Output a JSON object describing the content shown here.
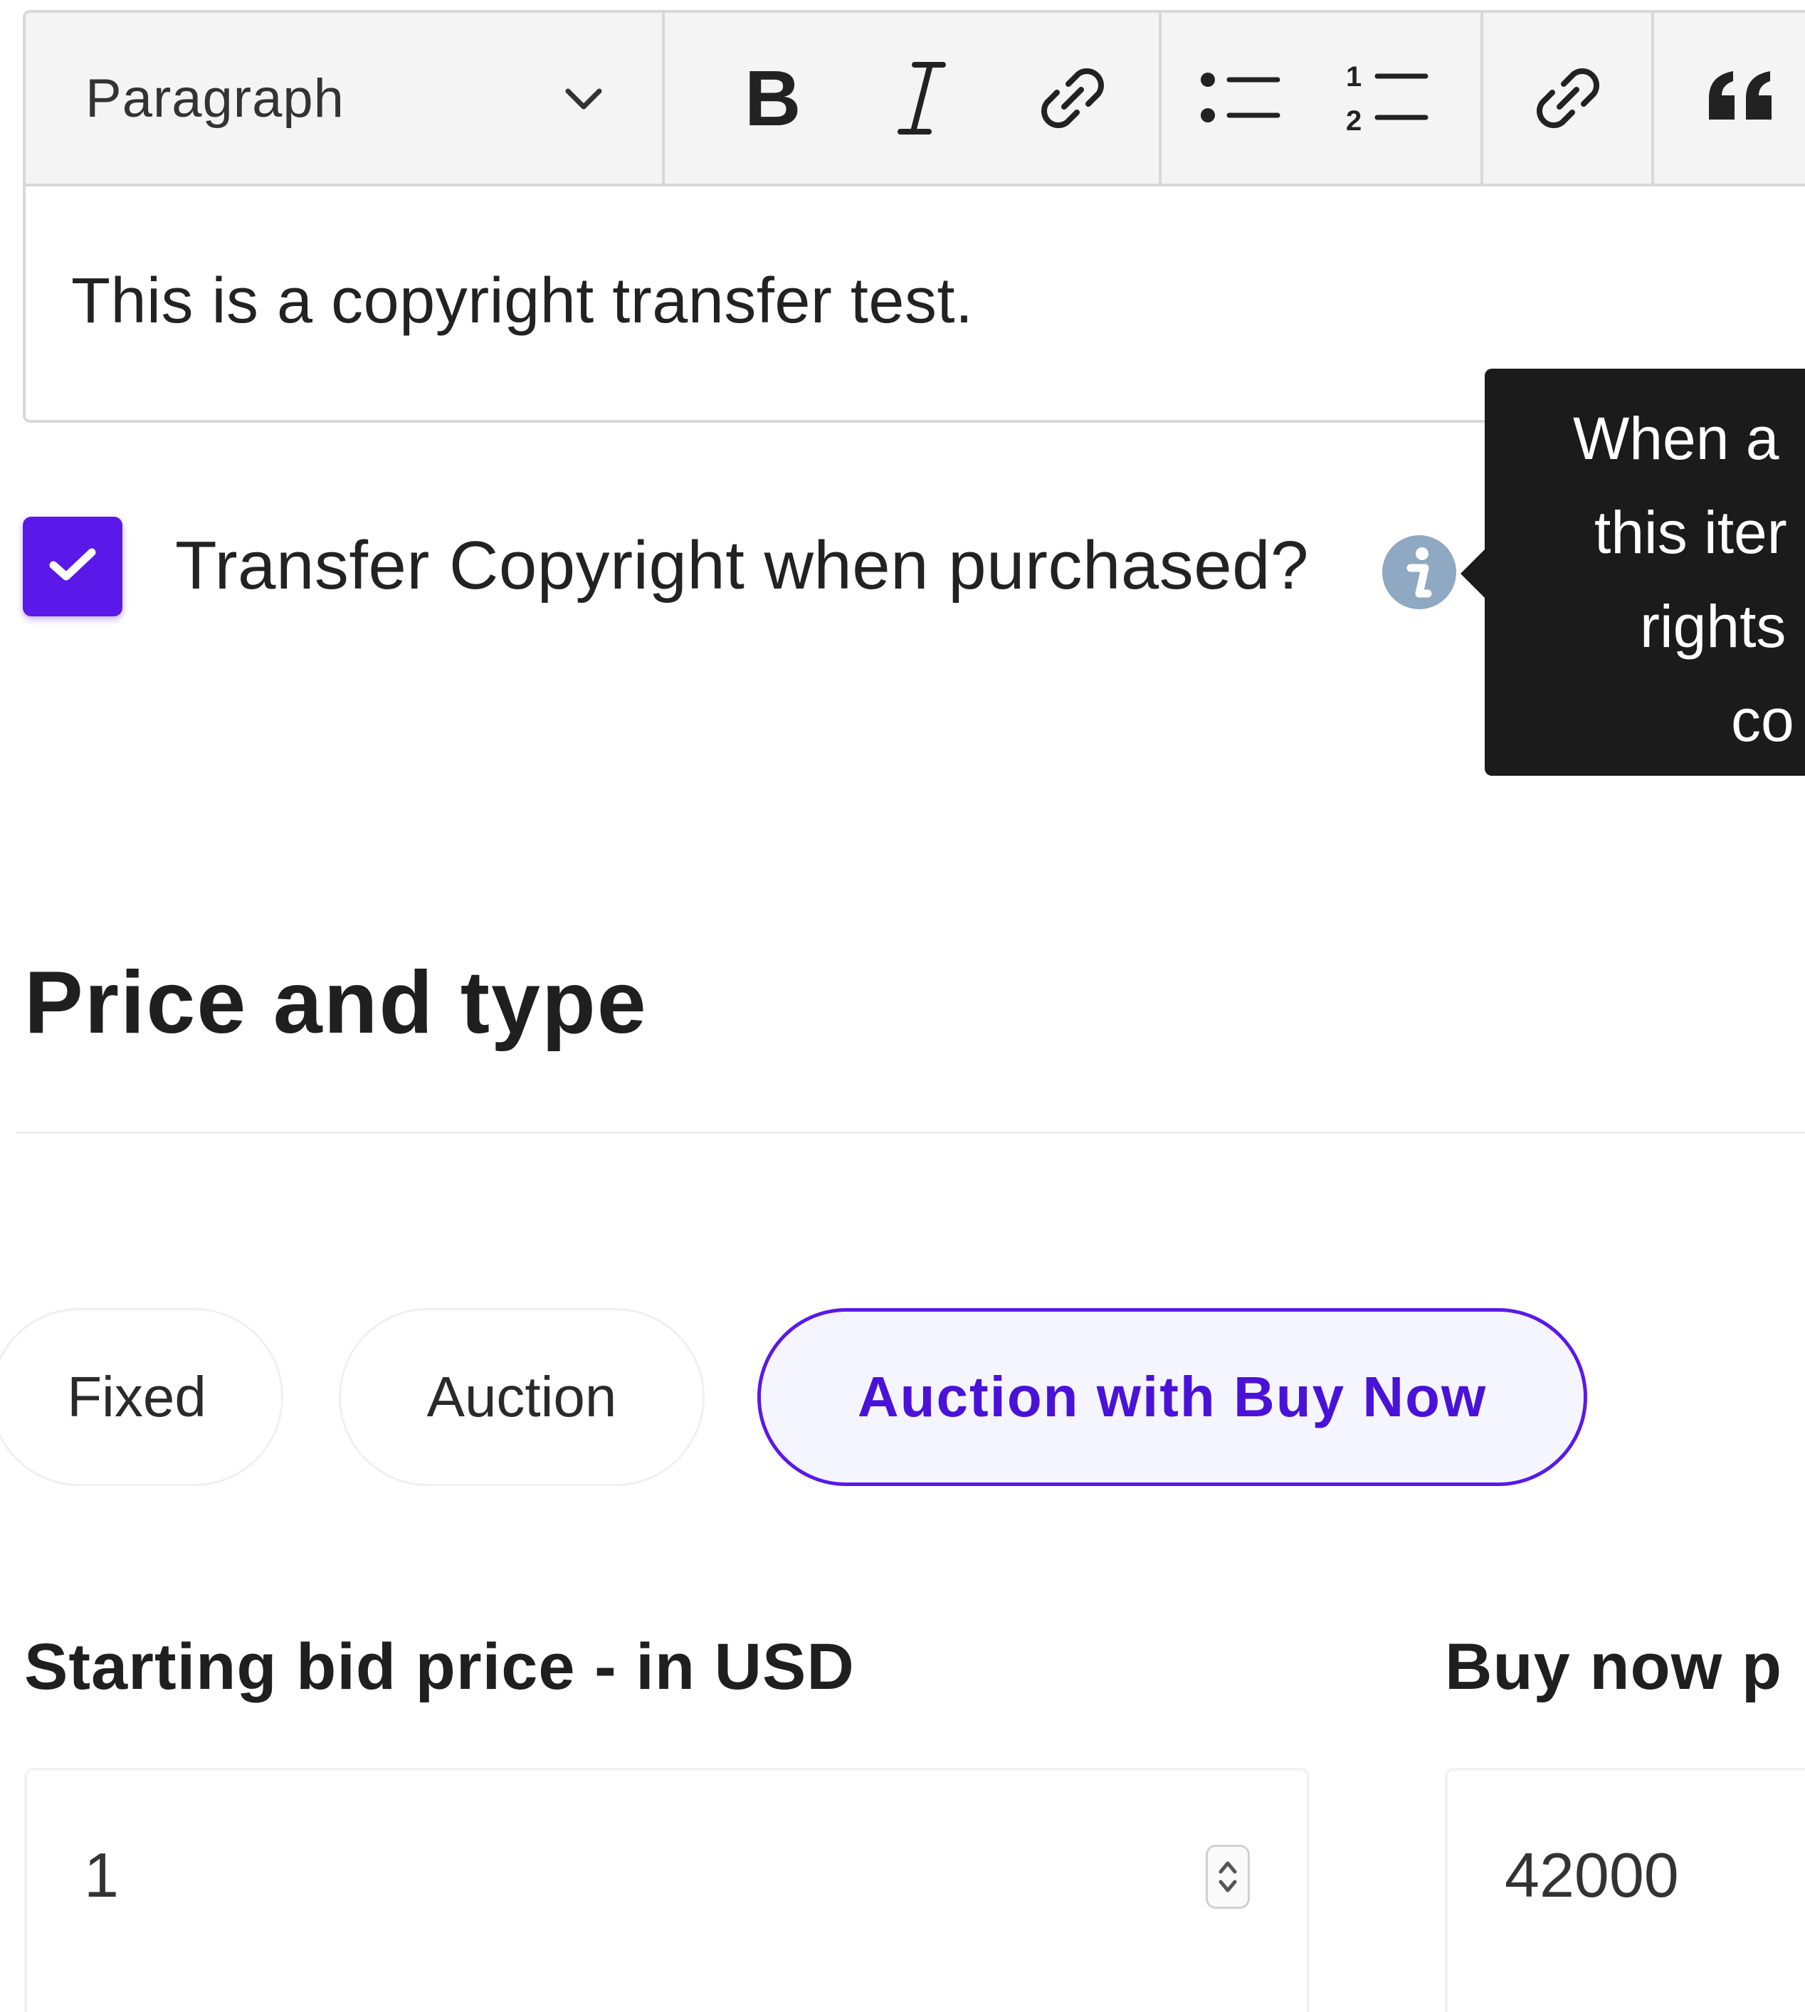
{
  "editor": {
    "format_select": {
      "value": "Paragraph",
      "icon": "chevron-down-icon"
    },
    "toolbar_icons": [
      "bold-icon",
      "italic-icon",
      "link-icon",
      "bulleted-list-icon",
      "numbered-list-icon",
      "link-icon",
      "quote-icon"
    ],
    "content": "This is a copyright transfer test."
  },
  "copyright": {
    "checked": true,
    "label": "Transfer Copyright when purchased?",
    "info_icon": "info-icon",
    "tooltip_lines": [
      "When a",
      "this iter",
      "rights",
      "co"
    ]
  },
  "price_section": {
    "title": "Price and type",
    "types": [
      "Fixed",
      "Auction",
      "Auction with Buy Now"
    ],
    "selected_type": "Auction with Buy Now",
    "starting_bid": {
      "label": "Starting bid price - in USD",
      "value": "1"
    },
    "buy_now": {
      "label": "Buy now p",
      "value": "42000"
    }
  },
  "colors": {
    "accent": "#5a19e8",
    "info_icon": "#8ea9c1",
    "tooltip_bg": "#1b1b1b"
  }
}
